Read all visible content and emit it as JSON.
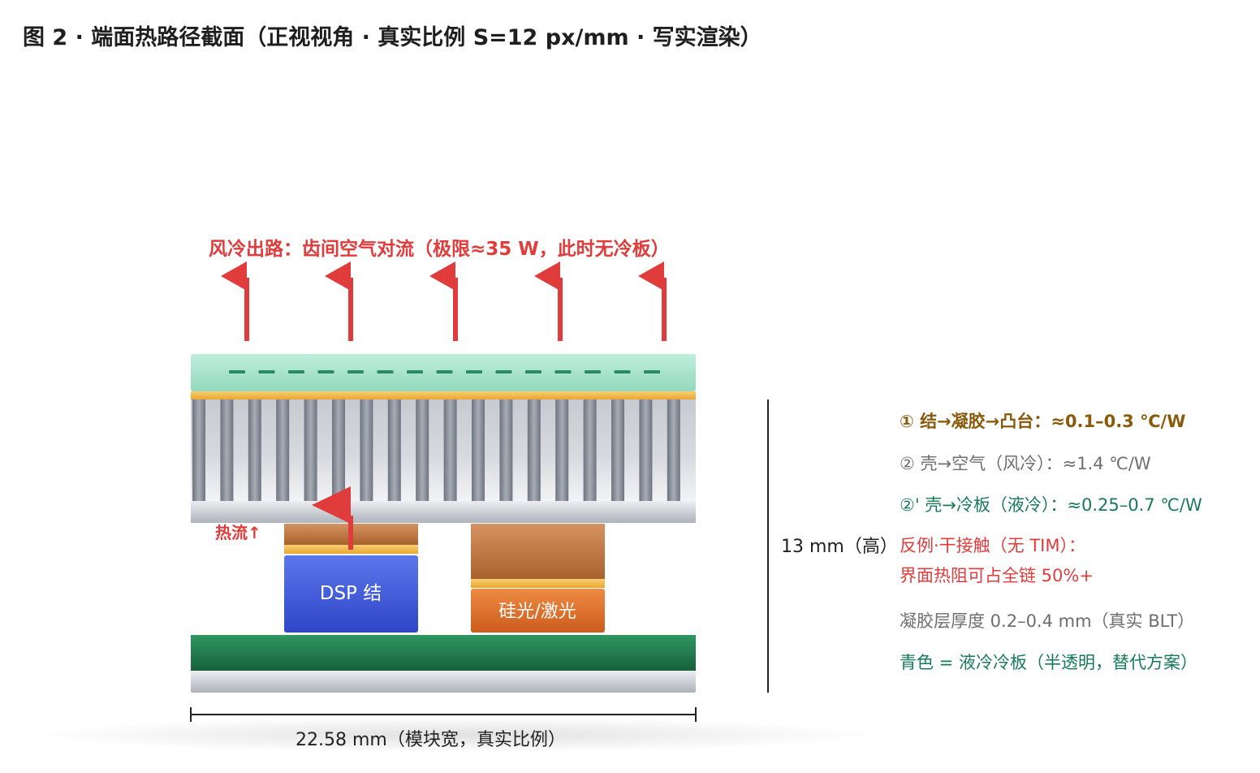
{
  "title": "图 2 · 端面热路径截面（正视视角 · 真实比例 S=12 px/mm · 写实渲染）",
  "air_path_label": "风冷出路：齿间空气对流（极限≈35 W，此时无冷板）",
  "heat_flow_label": "热流↑",
  "components": {
    "dsp_label": "DSP 结",
    "laser_label": "硅光/激光"
  },
  "dimensions": {
    "height_label": "13 mm（高）",
    "width_label": "22.58 mm（模块宽，真实比例）"
  },
  "legend": {
    "r1": "① 结→凝胶→凸台：≈0.1–0.3 ℃/W",
    "r2": "② 壳→空气（风冷）：≈1.4 ℃/W",
    "r3": "②' 壳→冷板（液冷）：≈0.25–0.7 ℃/W",
    "r4": "反例·干接触（无 TIM）：",
    "r5": "界面热阻可占全链 50%+",
    "r6": "凝胶层厚度 0.2–0.4 mm（真实 BLT）",
    "r7": "青色 = 液冷冷板（半透明，替代方案）"
  },
  "colors": {
    "accent_red": "#e03c3c",
    "brown_text": "#8a5a0b",
    "green_text": "#177a5a",
    "gray_text": "#6e6e6e",
    "cold_plate": "#a9e3cc",
    "pcb_green": "#1f7a4d",
    "dsp_blue": "#3a56d8",
    "laser_orange": "#e0752e",
    "copper": "#c9824b",
    "gel_gold": "#f1b84a"
  }
}
